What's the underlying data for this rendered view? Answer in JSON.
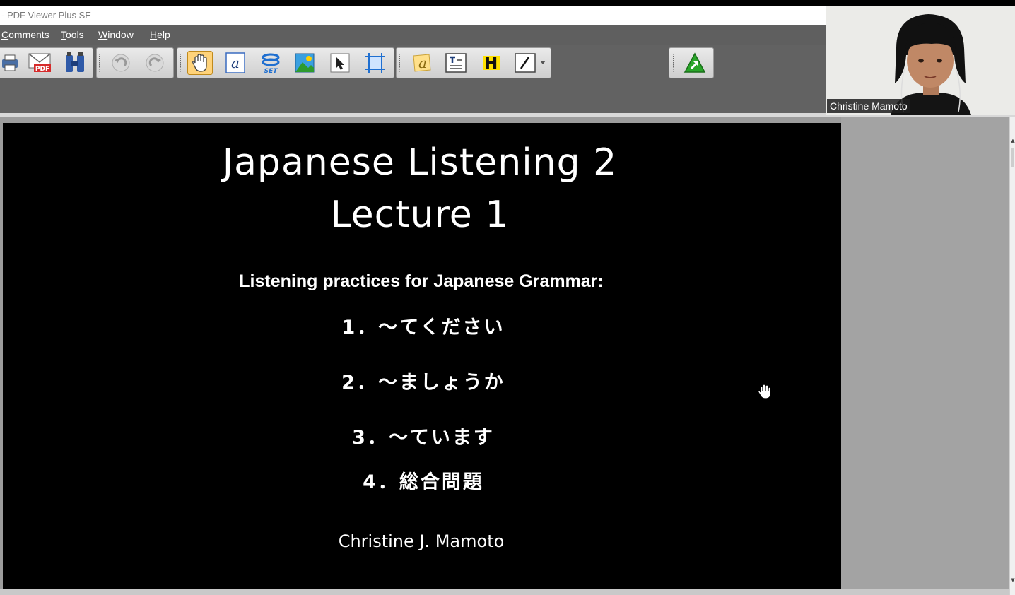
{
  "app": {
    "title": "- PDF Viewer Plus SE"
  },
  "menu": {
    "items": [
      {
        "mnemonic": "C",
        "rest": "omments"
      },
      {
        "mnemonic": "T",
        "rest": "ools"
      },
      {
        "mnemonic": "W",
        "rest": "indow"
      },
      {
        "mnemonic": "H",
        "rest": "elp"
      }
    ]
  },
  "toolbar": {
    "icons": [
      "print-icon",
      "email-pdf-icon",
      "find-binoculars-icon",
      "undo-icon",
      "redo-icon",
      "hand-tool-icon",
      "typewriter-text-icon",
      "set-tool-icon",
      "image-tool-icon",
      "select-arrow-icon",
      "crop-tool-icon",
      "note-comment-icon",
      "textbox-icon",
      "highlight-icon",
      "pencil-draw-icon",
      "upgrade-arrow-icon"
    ],
    "active_tool": "hand-tool",
    "special_labels": {
      "pdf": "PDF",
      "set": "SET",
      "highlight": "H"
    }
  },
  "slide": {
    "title_line1": "Japanese Listening 2",
    "title_line2": "Lecture 1",
    "subtitle": "Listening practices for Japanese Grammar:",
    "items": [
      "1．～てください",
      "2．～ましょうか",
      "3．～ています",
      "4．総合問題"
    ],
    "author": "Christine J. Mamoto"
  },
  "video": {
    "participant_name": "Christine Mamoto"
  },
  "colors": {
    "toolbar_bg": "#626262",
    "menubar_bg": "#5f5f5f",
    "active_tool_bg": "#ffd37a",
    "slide_bg": "#000000",
    "slide_text": "#ffffff"
  }
}
